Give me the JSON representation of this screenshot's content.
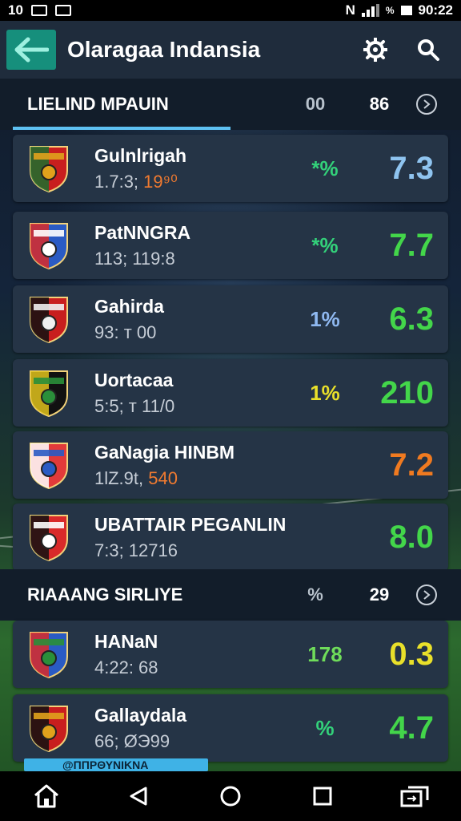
{
  "status_bar": {
    "time_left": "10",
    "network": "N",
    "battery_pct": "%",
    "time_right": "90:22"
  },
  "app_bar": {
    "title": "Olaragaa Indansia",
    "icons": [
      "back-arrow-icon",
      "gear-icon",
      "search-icon"
    ]
  },
  "section1": {
    "title": "LIELIND MPAUIN",
    "meta1": "00",
    "meta2": "86"
  },
  "section2": {
    "title": "RIAAANG SIRLIYE",
    "meta1": "%",
    "meta2": "29"
  },
  "teams": [
    {
      "name": "Gulnlrigah",
      "stat": "1.7:3; ",
      "stat_hl": "19⁹⁰",
      "pct": "*%",
      "pct_color": "#33d17a",
      "score": "7.3",
      "score_color": "#8fc4f0",
      "crest": [
        "#c81e1e",
        "#1b6e2e",
        "#e0a21c"
      ]
    },
    {
      "name": "PatNNGRA",
      "stat": "113; 119:8",
      "stat_hl": "",
      "pct": "*%",
      "pct_color": "#33d17a",
      "score": "7.7",
      "score_color": "#43d64a",
      "crest": [
        "#2a5bc4",
        "#d92a2a",
        "#ffffff"
      ]
    },
    {
      "name": "Gahirda",
      "stat": "93: т 00",
      "stat_hl": "",
      "pct": "1%",
      "pct_color": "#8fb8f0",
      "score": "6.3",
      "score_color": "#43d64a",
      "crest": [
        "#c81e1e",
        "#111111",
        "#f0f0f0"
      ]
    },
    {
      "name": "Uortacaa",
      "stat": "5:5; т 11/0",
      "stat_hl": "",
      "pct": "1%",
      "pct_color": "#e9e02a",
      "score": "210",
      "score_color": "#43d64a",
      "crest": [
        "#111111",
        "#e0c21c",
        "#2a8f3a"
      ]
    },
    {
      "name": "GaNagia HINBM",
      "stat": "1lZ.9t, ",
      "stat_hl": "540",
      "pct": "",
      "pct_color": "#33d17a",
      "score": "7.2",
      "score_color": "#f07a20",
      "crest": [
        "#e23a3a",
        "#ffffff",
        "#2a5bc4"
      ]
    },
    {
      "name": "UBATTAIR PEGANLIN",
      "stat": "7:3; 12716",
      "stat_hl": "",
      "pct": "",
      "pct_color": "#33d17a",
      "score": "8.0",
      "score_color": "#43d64a",
      "crest": [
        "#d92a2a",
        "#111111",
        "#ffffff"
      ]
    },
    {
      "name": "HANaN",
      "stat": "4:22: 68",
      "stat_hl": "",
      "pct": "178",
      "pct_color": "#6fdc5a",
      "score": "0.3",
      "score_color": "#e9e02a",
      "crest": [
        "#2a5bc4",
        "#d92a2a",
        "#2a8f3a"
      ]
    },
    {
      "name": "Gallaydala",
      "stat": "66; ØЭ99",
      "stat_hl": "",
      "pct": "%",
      "pct_color": "#33d17a",
      "score": "4.7",
      "score_color": "#43d64a",
      "crest": [
        "#c81e1e",
        "#111111",
        "#e0a21c"
      ]
    }
  ],
  "bottom_strip": "@ΠΠΡΘΥΝΙΚΝΑ",
  "nav_bar": [
    "home-icon",
    "back-icon",
    "circle-home-icon",
    "recents-icon",
    "switch-icon"
  ]
}
